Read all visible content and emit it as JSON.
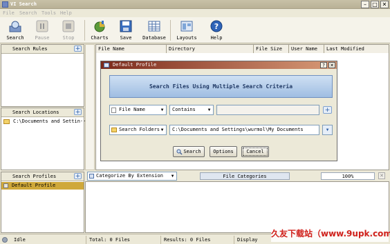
{
  "window": {
    "title": "VI Search"
  },
  "menu": [
    "File",
    "Search",
    "Tools",
    "Help"
  ],
  "toolbar": {
    "search": "Search",
    "pause": "Pause",
    "stop": "Stop",
    "charts": "Charts",
    "save": "Save",
    "database": "Database",
    "layouts": "Layouts",
    "help": "Help"
  },
  "left": {
    "search_rules": "Search Rules",
    "search_locations": "Search Locations",
    "location_item": "C:\\Documents and Settin··",
    "search_profiles": "Search Profiles",
    "profile_item": "Default Profile"
  },
  "results": {
    "columns": [
      "File Name",
      "Directory",
      "File Size",
      "User Name",
      "Last Modified"
    ]
  },
  "dialog": {
    "title": "Default Profile",
    "help_btn": "?",
    "close_btn": "✕",
    "banner": "Search Files Using Multiple Search Criteria",
    "rule_field": "File Name",
    "rule_op": "Contains",
    "rule_value": "",
    "location_field": "Search Folders",
    "location_path": "C:\\Documents and Settings\\wurmol\\My Documents",
    "search_btn": "Search",
    "options_btn": "Options",
    "cancel_btn": "Cancel"
  },
  "bottom": {
    "categorize": "Categorize By Extension",
    "file_categories": "File Categories",
    "zoom": "100%"
  },
  "status": {
    "state": "Idle",
    "total": "Total: 0 Files",
    "results": "Results: 0 Files",
    "display": "Display"
  },
  "watermark": "久友下载站（www.9upk.com）"
}
